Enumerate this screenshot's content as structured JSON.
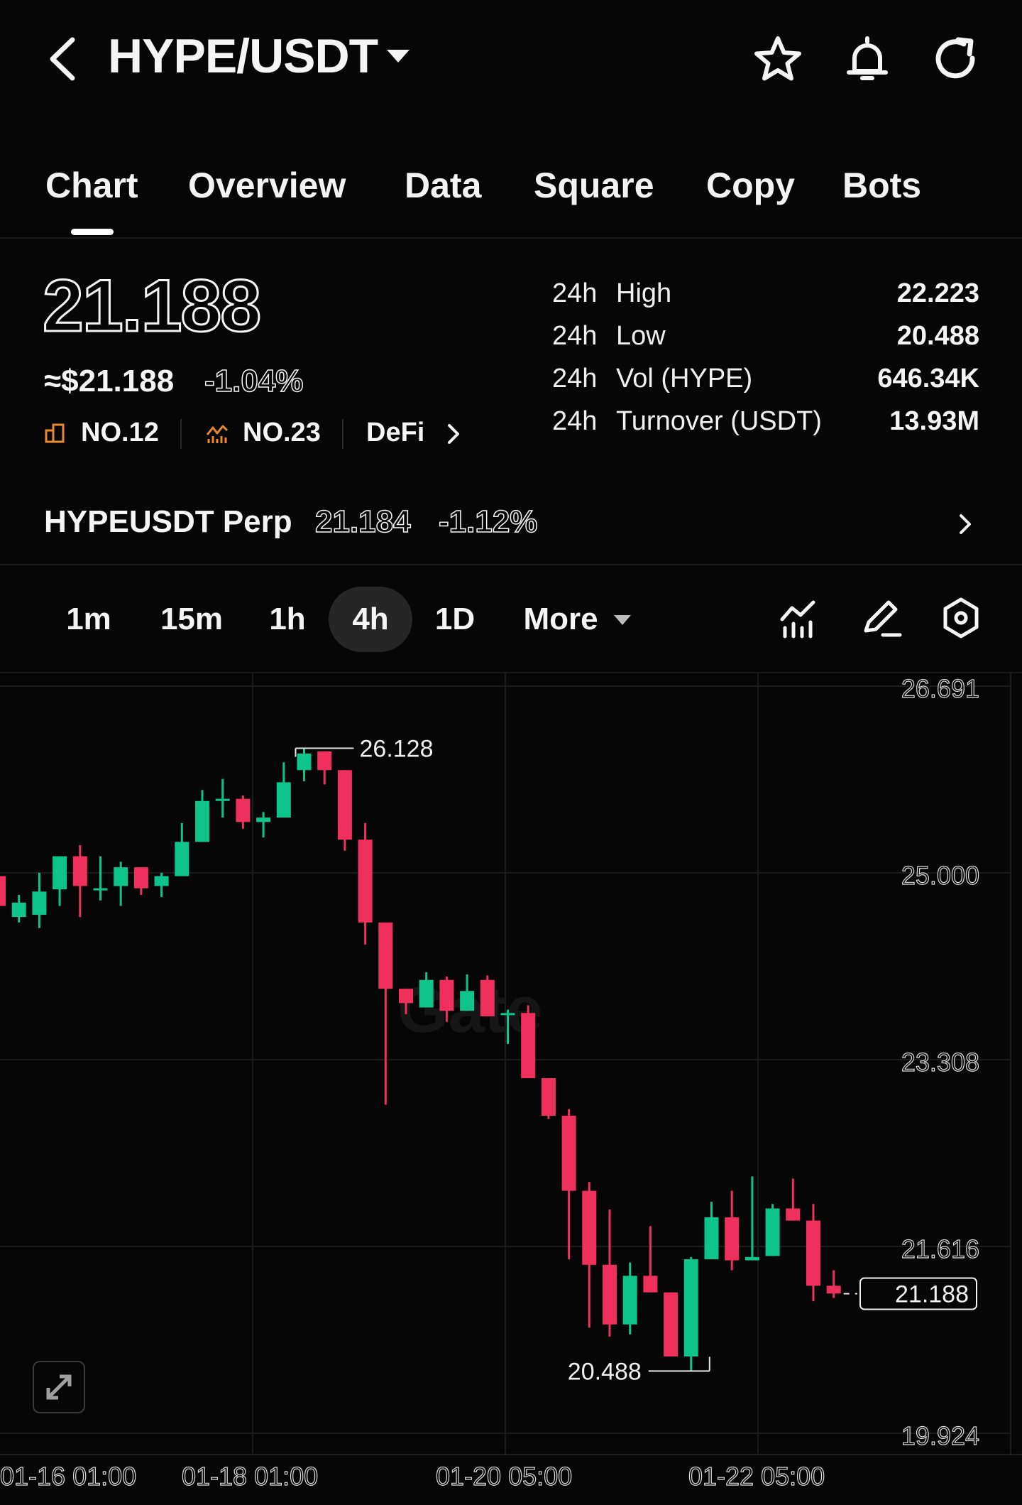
{
  "header": {
    "pair": "HYPE/USDT",
    "icons": [
      "back-arrow-icon",
      "caret-down-icon",
      "star-icon",
      "bell-icon",
      "refresh-icon"
    ]
  },
  "tabs": [
    {
      "label": "Chart",
      "active": true
    },
    {
      "label": "Overview"
    },
    {
      "label": "Data"
    },
    {
      "label": "Square"
    },
    {
      "label": "Copy"
    },
    {
      "label": "Bots"
    }
  ],
  "ticker": {
    "price": "21.188",
    "usd_price": "≈$21.188",
    "change": "-1.04%",
    "rank_1": "NO.12",
    "rank_2": "NO.23",
    "category": "DeFi"
  },
  "stats": [
    {
      "period": "24h",
      "label": "High",
      "value": "22.223"
    },
    {
      "period": "24h",
      "label": "Low",
      "value": "20.488"
    },
    {
      "period": "24h",
      "label": "Vol (HYPE)",
      "value": "646.34K"
    },
    {
      "period": "24h",
      "label": "Turnover (USDT)",
      "value": "13.93M"
    }
  ],
  "perp": {
    "name": "HYPEUSDT Perp",
    "price": "21.184",
    "change": "-1.12%"
  },
  "intervals": [
    "1m",
    "15m",
    "1h",
    "4h",
    "1D",
    "More"
  ],
  "active_interval": "4h",
  "colors": {
    "up": "#0ec48a",
    "down": "#f0305c",
    "background": "#060606"
  },
  "chart_data": {
    "type": "candlestick",
    "y_ticks": [
      "26.691",
      "25.000",
      "23.308",
      "21.616",
      "19.924"
    ],
    "ylim": [
      19.924,
      26.691
    ],
    "x_ticks": [
      "01-16 01:00",
      "01-18 01:00",
      "01-20 05:00",
      "01-22 05:00"
    ],
    "high_marker": "26.128",
    "low_marker": "20.488",
    "last_price": "21.188",
    "grid": true,
    "candles": [
      {
        "o": 24.97,
        "h": 25.15,
        "c": 24.7,
        "l": 24.45
      },
      {
        "o": 24.6,
        "h": 24.8,
        "c": 24.73,
        "l": 24.55
      },
      {
        "o": 24.62,
        "h": 25.0,
        "c": 24.83,
        "l": 24.5
      },
      {
        "o": 24.85,
        "h": 25.15,
        "c": 25.15,
        "l": 24.7
      },
      {
        "o": 25.15,
        "h": 25.25,
        "c": 24.88,
        "l": 24.6
      },
      {
        "o": 24.85,
        "h": 25.15,
        "c": 24.86,
        "l": 24.75
      },
      {
        "o": 24.88,
        "h": 25.1,
        "c": 25.05,
        "l": 24.7
      },
      {
        "o": 25.05,
        "h": 25.05,
        "c": 24.86,
        "l": 24.8
      },
      {
        "o": 24.88,
        "h": 25.0,
        "c": 24.97,
        "l": 24.78
      },
      {
        "o": 24.97,
        "h": 25.45,
        "c": 25.28,
        "l": 24.97
      },
      {
        "o": 25.28,
        "h": 25.75,
        "c": 25.65,
        "l": 25.28
      },
      {
        "o": 25.67,
        "h": 25.85,
        "c": 25.67,
        "l": 25.5
      },
      {
        "o": 25.67,
        "h": 25.7,
        "c": 25.46,
        "l": 25.4
      },
      {
        "o": 25.46,
        "h": 25.55,
        "c": 25.5,
        "l": 25.32
      },
      {
        "o": 25.5,
        "h": 26.0,
        "c": 25.82,
        "l": 25.5
      },
      {
        "o": 25.93,
        "h": 26.13,
        "c": 26.08,
        "l": 25.83
      },
      {
        "o": 26.1,
        "h": 26.1,
        "c": 25.93,
        "l": 25.8
      },
      {
        "o": 25.93,
        "h": 25.93,
        "c": 25.3,
        "l": 25.2
      },
      {
        "o": 25.3,
        "h": 25.45,
        "c": 24.55,
        "l": 24.35
      },
      {
        "o": 24.55,
        "h": 24.55,
        "c": 23.95,
        "l": 22.9
      },
      {
        "o": 23.95,
        "h": 23.95,
        "c": 23.82,
        "l": 23.72
      },
      {
        "o": 23.78,
        "h": 24.1,
        "c": 24.03,
        "l": 23.78
      },
      {
        "o": 24.03,
        "h": 24.06,
        "c": 23.75,
        "l": 23.65
      },
      {
        "o": 23.75,
        "h": 24.08,
        "c": 23.93,
        "l": 23.75
      },
      {
        "o": 24.03,
        "h": 24.07,
        "c": 23.7,
        "l": 23.7
      },
      {
        "o": 23.72,
        "h": 23.76,
        "c": 23.73,
        "l": 23.45
      },
      {
        "o": 23.73,
        "h": 23.8,
        "c": 23.14,
        "l": 23.14
      },
      {
        "o": 23.14,
        "h": 23.14,
        "c": 22.8,
        "l": 22.77
      },
      {
        "o": 22.8,
        "h": 22.86,
        "c": 22.12,
        "l": 21.5
      },
      {
        "o": 22.12,
        "h": 22.2,
        "c": 21.45,
        "l": 20.88
      },
      {
        "o": 21.45,
        "h": 21.95,
        "c": 20.91,
        "l": 20.8
      },
      {
        "o": 20.91,
        "h": 21.47,
        "c": 21.35,
        "l": 20.82
      },
      {
        "o": 21.35,
        "h": 21.8,
        "c": 21.2,
        "l": 21.2
      },
      {
        "o": 21.2,
        "h": 21.2,
        "c": 20.62,
        "l": 20.62
      },
      {
        "o": 20.62,
        "h": 21.52,
        "c": 21.5,
        "l": 20.49
      },
      {
        "o": 21.5,
        "h": 22.02,
        "c": 21.88,
        "l": 21.5
      },
      {
        "o": 21.88,
        "h": 22.12,
        "c": 21.49,
        "l": 21.4
      },
      {
        "o": 21.49,
        "h": 22.25,
        "c": 21.52,
        "l": 21.5
      },
      {
        "o": 21.53,
        "h": 22.0,
        "c": 21.96,
        "l": 21.53
      },
      {
        "o": 21.96,
        "h": 22.23,
        "c": 21.85,
        "l": 21.85
      },
      {
        "o": 21.85,
        "h": 22.0,
        "c": 21.26,
        "l": 21.12
      },
      {
        "o": 21.26,
        "h": 21.4,
        "c": 21.19,
        "l": 21.15
      }
    ]
  }
}
